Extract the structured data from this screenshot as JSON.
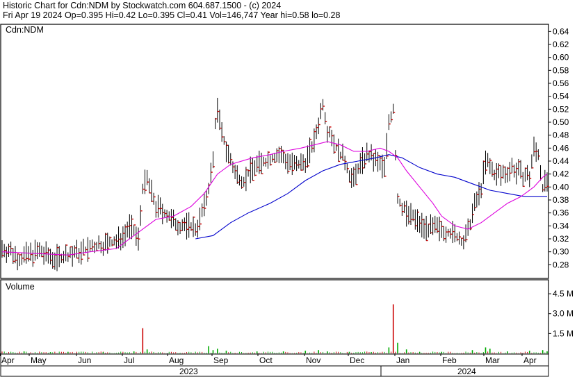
{
  "header": {
    "line1": "Historic Chart for Cdn:NDM by Stockwatch.com 604.687.1500 - (c) 2024",
    "line2": "Fri Apr 19 2024   Op=0.395  Hi=0.42  Lo=0.395  Cl=0.41  Vol=146,747  Year hi=0.58  lo=0.28"
  },
  "chart_data": [
    {
      "type": "ohlc",
      "label": "Cdn:NDM",
      "ylim": [
        0.26,
        0.65
      ],
      "y_ticks": [
        "0.64",
        "0.62",
        "0.60",
        "0.58",
        "0.56",
        "0.54",
        "0.52",
        "0.50",
        "0.48",
        "0.46",
        "0.44",
        "0.42",
        "0.40",
        "0.38",
        "0.36",
        "0.34",
        "0.32",
        "0.30",
        "0.28"
      ],
      "x_months": [
        "Apr",
        "May",
        "Jun",
        "Jul",
        "Aug",
        "Sep",
        "Oct",
        "Nov",
        "Dec",
        "Jan",
        "Feb",
        "Mar",
        "Apr"
      ],
      "x_years": [
        "2023",
        "2024"
      ],
      "price_path": [
        [
          0,
          0.305
        ],
        [
          4,
          0.3
        ],
        [
          8,
          0.29
        ],
        [
          12,
          0.295
        ],
        [
          16,
          0.3
        ],
        [
          20,
          0.295
        ],
        [
          24,
          0.29
        ],
        [
          30,
          0.295
        ],
        [
          36,
          0.3
        ],
        [
          44,
          0.31
        ],
        [
          52,
          0.315
        ],
        [
          56,
          0.33
        ],
        [
          58,
          0.34
        ],
        [
          60,
          0.33
        ],
        [
          62,
          0.32
        ],
        [
          64,
          0.4
        ],
        [
          66,
          0.41
        ],
        [
          68,
          0.39
        ],
        [
          70,
          0.37
        ],
        [
          74,
          0.36
        ],
        [
          78,
          0.345
        ],
        [
          82,
          0.34
        ],
        [
          86,
          0.34
        ],
        [
          88,
          0.335
        ],
        [
          90,
          0.35
        ],
        [
          92,
          0.37
        ],
        [
          94,
          0.4
        ],
        [
          96,
          0.44
        ],
        [
          97,
          0.5
        ],
        [
          98,
          0.52
        ],
        [
          100,
          0.48
        ],
        [
          102,
          0.46
        ],
        [
          104,
          0.44
        ],
        [
          106,
          0.42
        ],
        [
          110,
          0.41
        ],
        [
          114,
          0.43
        ],
        [
          120,
          0.44
        ],
        [
          126,
          0.45
        ],
        [
          130,
          0.44
        ],
        [
          134,
          0.43
        ],
        [
          138,
          0.44
        ],
        [
          142,
          0.47
        ],
        [
          144,
          0.5
        ],
        [
          146,
          0.53
        ],
        [
          148,
          0.49
        ],
        [
          150,
          0.48
        ],
        [
          152,
          0.46
        ],
        [
          156,
          0.44
        ],
        [
          158,
          0.42
        ],
        [
          160,
          0.41
        ],
        [
          162,
          0.43
        ],
        [
          166,
          0.45
        ],
        [
          170,
          0.44
        ],
        [
          174,
          0.43
        ],
        [
          176,
          0.5
        ],
        [
          178,
          0.52
        ],
        [
          180,
          0.38
        ],
        [
          182,
          0.37
        ],
        [
          184,
          0.36
        ],
        [
          188,
          0.35
        ],
        [
          192,
          0.34
        ],
        [
          196,
          0.335
        ],
        [
          200,
          0.335
        ],
        [
          204,
          0.33
        ],
        [
          208,
          0.32
        ],
        [
          210,
          0.315
        ],
        [
          212,
          0.33
        ],
        [
          214,
          0.36
        ],
        [
          216,
          0.38
        ],
        [
          218,
          0.4
        ],
        [
          220,
          0.44
        ],
        [
          222,
          0.43
        ],
        [
          224,
          0.42
        ],
        [
          228,
          0.42
        ],
        [
          232,
          0.43
        ],
        [
          236,
          0.42
        ],
        [
          240,
          0.415
        ],
        [
          242,
          0.46
        ],
        [
          244,
          0.45
        ],
        [
          246,
          0.4
        ],
        [
          248,
          0.41
        ]
      ],
      "ma_short": [
        [
          0,
          0.3
        ],
        [
          30,
          0.295
        ],
        [
          40,
          0.3
        ],
        [
          52,
          0.305
        ],
        [
          62,
          0.33
        ],
        [
          70,
          0.35
        ],
        [
          78,
          0.355
        ],
        [
          86,
          0.37
        ],
        [
          92,
          0.39
        ],
        [
          98,
          0.42
        ],
        [
          104,
          0.435
        ],
        [
          114,
          0.445
        ],
        [
          122,
          0.45
        ],
        [
          128,
          0.455
        ],
        [
          136,
          0.46
        ],
        [
          142,
          0.465
        ],
        [
          148,
          0.47
        ],
        [
          154,
          0.465
        ],
        [
          160,
          0.455
        ],
        [
          166,
          0.455
        ],
        [
          172,
          0.46
        ],
        [
          176,
          0.455
        ],
        [
          180,
          0.445
        ],
        [
          184,
          0.425
        ],
        [
          190,
          0.4
        ],
        [
          196,
          0.375
        ],
        [
          200,
          0.355
        ],
        [
          206,
          0.34
        ],
        [
          212,
          0.335
        ],
        [
          218,
          0.345
        ],
        [
          224,
          0.36
        ],
        [
          230,
          0.375
        ],
        [
          236,
          0.385
        ],
        [
          242,
          0.4
        ],
        [
          246,
          0.415
        ],
        [
          248,
          0.42
        ]
      ],
      "ma_long": [
        [
          88,
          0.32
        ],
        [
          96,
          0.325
        ],
        [
          104,
          0.345
        ],
        [
          112,
          0.36
        ],
        [
          122,
          0.375
        ],
        [
          130,
          0.39
        ],
        [
          138,
          0.41
        ],
        [
          146,
          0.425
        ],
        [
          154,
          0.435
        ],
        [
          162,
          0.44
        ],
        [
          170,
          0.445
        ],
        [
          176,
          0.45
        ],
        [
          182,
          0.445
        ],
        [
          190,
          0.43
        ],
        [
          198,
          0.42
        ],
        [
          206,
          0.415
        ],
        [
          214,
          0.405
        ],
        [
          222,
          0.395
        ],
        [
          230,
          0.39
        ],
        [
          238,
          0.385
        ],
        [
          248,
          0.385
        ]
      ]
    },
    {
      "type": "bar",
      "label": "Volume",
      "ylim": [
        0,
        5.5
      ],
      "y_ticks": [
        "4.5 M",
        "3.0 M",
        "1.5 M"
      ],
      "bars": [
        [
          10,
          0.15
        ],
        [
          22,
          0.1
        ],
        [
          30,
          0.12
        ],
        [
          46,
          0.1
        ],
        [
          60,
          0.15
        ],
        [
          64,
          1.9
        ],
        [
          66,
          0.3
        ],
        [
          94,
          0.55
        ],
        [
          96,
          0.25
        ],
        [
          98,
          0.35
        ],
        [
          102,
          0.2
        ],
        [
          116,
          0.15
        ],
        [
          128,
          0.15
        ],
        [
          138,
          0.2
        ],
        [
          144,
          0.25
        ],
        [
          148,
          0.15
        ],
        [
          158,
          0.12
        ],
        [
          168,
          0.1
        ],
        [
          176,
          0.45
        ],
        [
          178,
          3.7
        ],
        [
          180,
          0.8
        ],
        [
          184,
          0.3
        ],
        [
          190,
          0.1
        ],
        [
          200,
          0.12
        ],
        [
          214,
          0.25
        ],
        [
          220,
          0.45
        ],
        [
          222,
          0.35
        ],
        [
          230,
          0.15
        ],
        [
          240,
          0.2
        ],
        [
          246,
          0.25
        ],
        [
          248,
          0.15
        ]
      ]
    }
  ],
  "colors": {
    "bar": "#000000",
    "close": "#cc0000",
    "ma_short": "#dd00dd",
    "ma_long": "#0000cc",
    "vol_up": "#00aa00",
    "vol_down": "#cc0000"
  }
}
